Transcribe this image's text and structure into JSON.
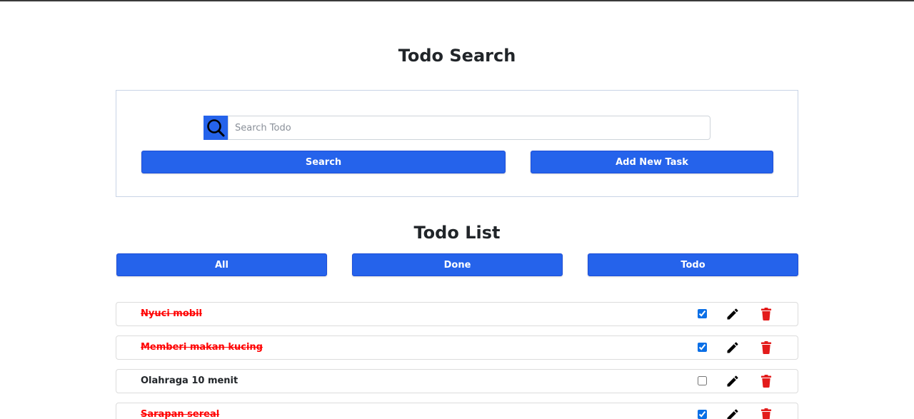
{
  "header": {
    "title": "Todo Search"
  },
  "search": {
    "icon": "search-icon",
    "placeholder": "Search Todo",
    "value": "",
    "search_button_label": "Search",
    "add_button_label": "Add New Task",
    "accent_color": "#2563eb"
  },
  "list": {
    "title": "Todo List",
    "filters": [
      {
        "label": "All"
      },
      {
        "label": "Done"
      },
      {
        "label": "Todo"
      }
    ],
    "items": [
      {
        "text": "Nyuci mobil",
        "done": true
      },
      {
        "text": "Memberi makan kucing",
        "done": true
      },
      {
        "text": "Olahraga 10 menit",
        "done": false
      },
      {
        "text": "Sarapan sereal",
        "done": true
      }
    ],
    "done_text_color": "#ff0000",
    "delete_icon_color": "#e31b1b",
    "edit_icon": "pencil-icon",
    "delete_icon": "trash-icon"
  }
}
